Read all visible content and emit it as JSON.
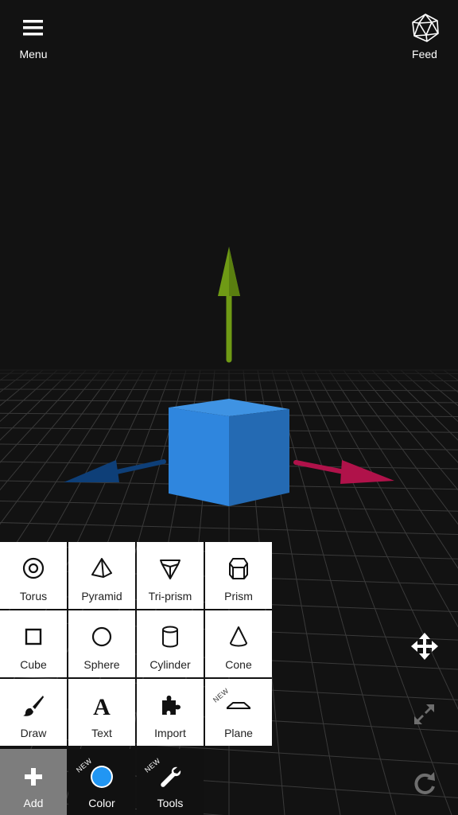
{
  "header": {
    "menu_label": "Menu",
    "feed_label": "Feed"
  },
  "palette": {
    "new_tag": "NEW",
    "items": [
      {
        "label": "Torus",
        "icon": "torus-icon"
      },
      {
        "label": "Pyramid",
        "icon": "pyramid-icon"
      },
      {
        "label": "Tri-prism",
        "icon": "tri-prism-icon"
      },
      {
        "label": "Prism",
        "icon": "prism-icon"
      },
      {
        "label": "Cube",
        "icon": "cube-icon"
      },
      {
        "label": "Sphere",
        "icon": "sphere-icon"
      },
      {
        "label": "Cylinder",
        "icon": "cylinder-icon"
      },
      {
        "label": "Cone",
        "icon": "cone-icon"
      },
      {
        "label": "Draw",
        "icon": "brush-icon"
      },
      {
        "label": "Text",
        "icon": "text-icon"
      },
      {
        "label": "Import",
        "icon": "puzzle-icon"
      },
      {
        "label": "Plane",
        "icon": "plane-icon",
        "is_new": true
      }
    ]
  },
  "bottom_bar": {
    "add_label": "Add",
    "color_label": "Color",
    "tools_label": "Tools",
    "new_tag": "NEW"
  },
  "colors": {
    "background": "#121212",
    "cube_top": "#3f93e3",
    "cube_front": "#2f86de",
    "cube_side": "#246ab3",
    "axis_y": "#6f9a15",
    "axis_x": "#b0124a",
    "axis_z": "#0e3f78",
    "selected_color": "#2196f3",
    "add_active": "#7d7d7d"
  },
  "side_tools": [
    "move-icon",
    "scale-icon",
    "redo-icon"
  ]
}
